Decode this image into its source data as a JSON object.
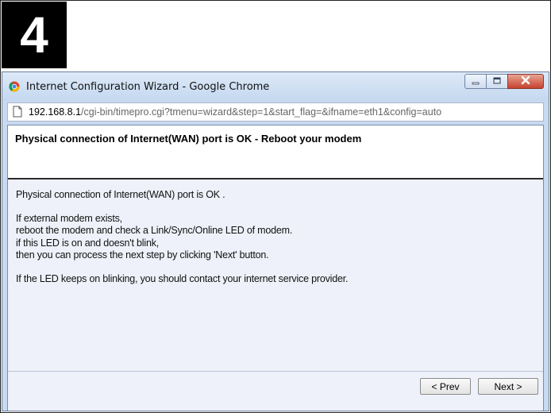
{
  "step_badge": "4",
  "window": {
    "title": "Internet Configuration Wizard - Google Chrome",
    "address": {
      "host": "192.168.8.1",
      "path": "/cgi-bin/timepro.cgi?tmenu=wizard&step=1&start_flag=&ifname=eth1&config=auto"
    }
  },
  "page": {
    "heading": "Physical connection of Internet(WAN) port is OK - Reboot your modem",
    "lines": [
      "Physical connection of Internet(WAN) port is OK .",
      "If external modem exists,",
      "reboot the modem and check a Link/Sync/Online LED of modem.",
      "if this LED is on and doesn't blink,",
      "then you can process the next step by clicking 'Next' button.",
      "If the LED keeps on blinking, you should contact your internet service provider."
    ],
    "buttons": {
      "prev": "< Prev",
      "next": "Next >"
    }
  },
  "icons": {
    "browser": "chrome-icon",
    "page": "page-icon",
    "minimize": "minimize-icon",
    "maximize": "maximize-icon",
    "close": "close-icon"
  }
}
